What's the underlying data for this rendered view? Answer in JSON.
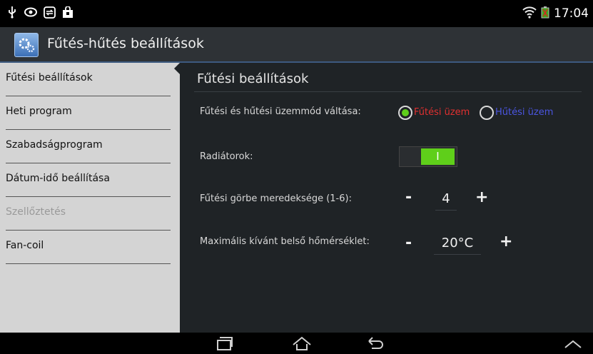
{
  "status_bar": {
    "left_icons": [
      "usb-icon",
      "eye-icon",
      "sync-icon",
      "bag-icon"
    ],
    "wifi_icon": "wifi-icon",
    "battery_icon": "battery-icon",
    "time": "17:04"
  },
  "action_bar": {
    "app_icon": "settings-app-icon",
    "title": "Fűtés-hűtés beállítások"
  },
  "sidebar": {
    "items": [
      {
        "label": "Fűtési beállítások",
        "active": true,
        "disabled": false
      },
      {
        "label": "Heti program",
        "active": false,
        "disabled": false
      },
      {
        "label": "Szabadságprogram",
        "active": false,
        "disabled": false
      },
      {
        "label": "Dátum-idő beállítása",
        "active": false,
        "disabled": false
      },
      {
        "label": "Szellőztetés",
        "active": false,
        "disabled": true
      },
      {
        "label": "Fan-coil",
        "active": false,
        "disabled": false
      }
    ]
  },
  "main": {
    "title": "Fűtési beállítások",
    "mode_label": "Fűtési és hűtési üzemmód váltása:",
    "mode_options": [
      {
        "label": "Fűtési üzem",
        "selected": true,
        "color": "#e03030"
      },
      {
        "label": "Hűtési üzem",
        "selected": false,
        "color": "#4a55e0"
      }
    ],
    "radiators_label": "Radiátorok:",
    "radiators_toggle_text": "I",
    "radiators_on": true,
    "curve_label": "Fűtési görbe meredeksége (1-6):",
    "curve_value": "4",
    "max_temp_label": "Maximális kívánt belső hőmérséklet:",
    "max_temp_value": "20°C",
    "minus_label": "-",
    "plus_label": "+"
  },
  "nav_bar": {
    "icons": [
      "recent-apps-icon",
      "home-icon",
      "back-icon",
      "chevron-up-icon"
    ]
  },
  "colors": {
    "accent_green": "#5fcf1a",
    "heating_red": "#e03030",
    "cooling_blue": "#4a55e0",
    "panel_bg": "#1f2326",
    "sidebar_bg": "#d4d4d4"
  }
}
